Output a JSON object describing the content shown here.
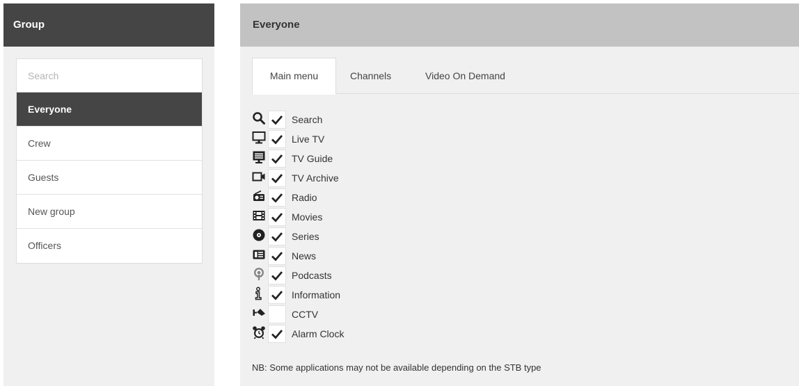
{
  "groups_panel": {
    "title": "Group",
    "search": {
      "placeholder": "Search",
      "value": ""
    },
    "items": [
      {
        "label": "Everyone",
        "selected": true
      },
      {
        "label": "Crew",
        "selected": false
      },
      {
        "label": "Guests",
        "selected": false
      },
      {
        "label": "New group",
        "selected": false
      },
      {
        "label": "Officers",
        "selected": false
      }
    ]
  },
  "detail_panel": {
    "title": "Everyone",
    "tabs": [
      {
        "label": "Main menu",
        "active": true
      },
      {
        "label": "Channels",
        "active": false
      },
      {
        "label": "Video On Demand",
        "active": false
      }
    ],
    "apps": [
      {
        "label": "Search",
        "icon": "search-icon",
        "checked": true
      },
      {
        "label": "Live TV",
        "icon": "monitor-icon",
        "checked": true
      },
      {
        "label": "TV Guide",
        "icon": "tv-guide-icon",
        "checked": true
      },
      {
        "label": "TV Archive",
        "icon": "video-camera-icon",
        "checked": true
      },
      {
        "label": "Radio",
        "icon": "radio-icon",
        "checked": true
      },
      {
        "label": "Movies",
        "icon": "film-icon",
        "checked": true
      },
      {
        "label": "Series",
        "icon": "disc-icon",
        "checked": true
      },
      {
        "label": "News",
        "icon": "newspaper-icon",
        "checked": true
      },
      {
        "label": "Podcasts",
        "icon": "podcast-icon",
        "checked": true
      },
      {
        "label": "Information",
        "icon": "info-icon",
        "checked": true
      },
      {
        "label": "CCTV",
        "icon": "cctv-camera-icon",
        "checked": false
      },
      {
        "label": "Alarm Clock",
        "icon": "alarm-clock-icon",
        "checked": true
      }
    ],
    "note": "NB: Some applications may not be available depending on the STB type"
  },
  "colors": {
    "header_dark": "#454545",
    "header_light": "#c2c2c2",
    "panel_bg": "#f0f0f0",
    "selected_item": "#454545"
  }
}
